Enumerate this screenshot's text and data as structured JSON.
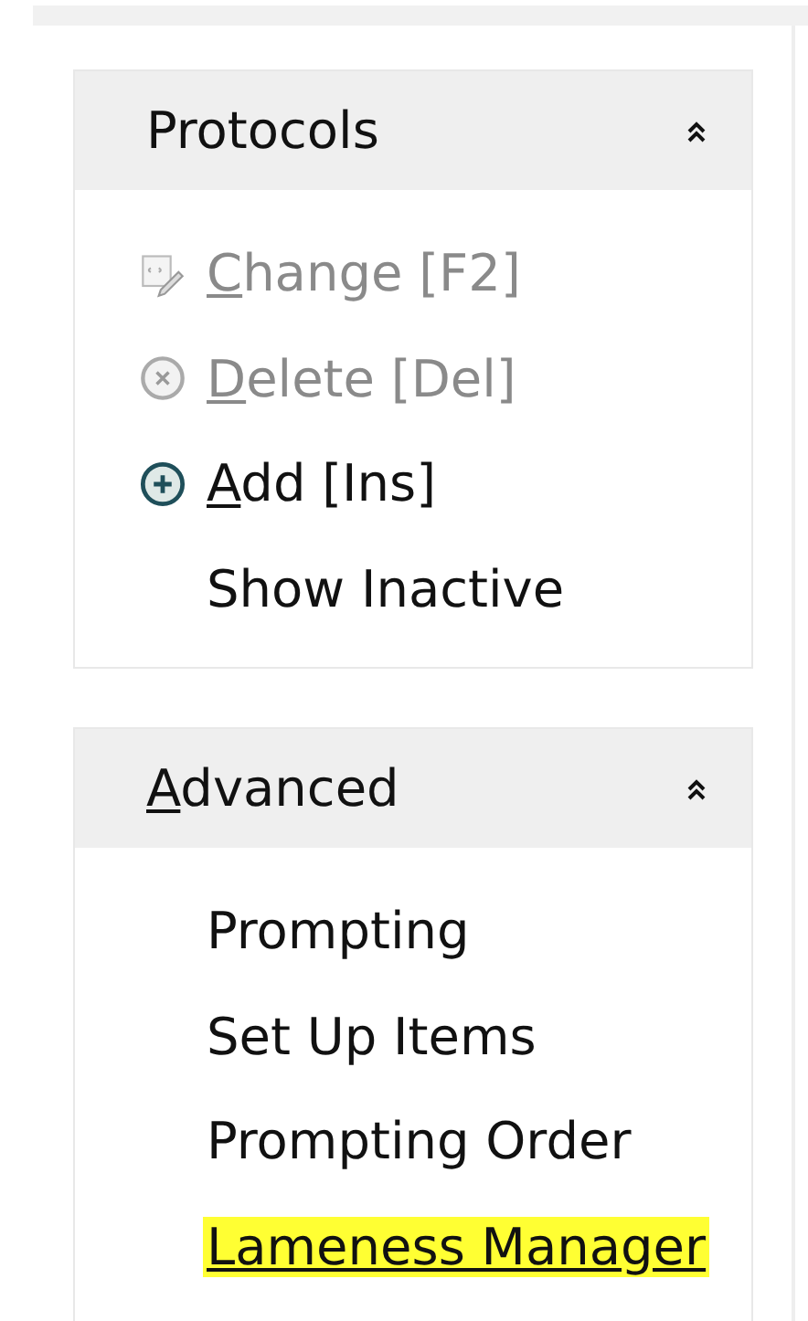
{
  "panels": [
    {
      "title": "Protocols",
      "title_mnemonic": false,
      "expanded": true,
      "items": [
        {
          "label": "Change [F2]",
          "kind": "edit",
          "mnemonic": true,
          "disabled": true,
          "highlighted": false,
          "underlined": false
        },
        {
          "label": "Delete [Del]",
          "kind": "delete",
          "mnemonic": true,
          "disabled": true,
          "highlighted": false,
          "underlined": false
        },
        {
          "label": "Add [Ins]",
          "kind": "add",
          "mnemonic": true,
          "disabled": false,
          "highlighted": false,
          "underlined": false
        },
        {
          "label": "Show Inactive",
          "kind": "plain",
          "mnemonic": false,
          "disabled": false,
          "highlighted": false,
          "underlined": false
        }
      ]
    },
    {
      "title": "Advanced",
      "title_mnemonic": true,
      "expanded": true,
      "items": [
        {
          "label": "Prompting",
          "kind": "plain",
          "mnemonic": false,
          "disabled": false,
          "highlighted": false,
          "underlined": false
        },
        {
          "label": "Set Up Items",
          "kind": "plain",
          "mnemonic": false,
          "disabled": false,
          "highlighted": false,
          "underlined": false
        },
        {
          "label": "Prompting Order",
          "kind": "plain",
          "mnemonic": false,
          "disabled": false,
          "highlighted": false,
          "underlined": false
        },
        {
          "label": "Lameness Manager",
          "kind": "plain",
          "mnemonic": false,
          "disabled": false,
          "highlighted": true,
          "underlined": true
        }
      ]
    }
  ]
}
